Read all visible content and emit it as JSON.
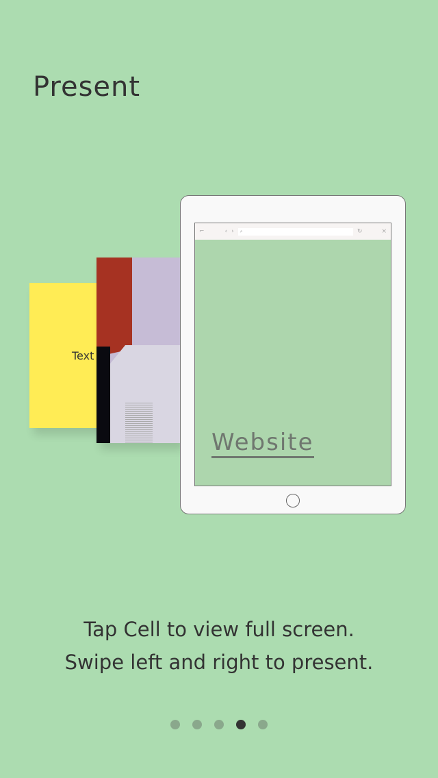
{
  "title": "Present",
  "cards": {
    "text_card_label": "Text",
    "website_label": "Website"
  },
  "browser": {
    "back": "‹",
    "forward": "›",
    "search_icon": "⌕",
    "reload": "↻",
    "close": "×",
    "menu": "⌐"
  },
  "caption": {
    "line1": "Tap Cell to view full screen.",
    "line2": "Swipe left and right to present."
  },
  "pager": {
    "count": 5,
    "active_index": 3
  },
  "colors": {
    "background": "#acdcb0",
    "yellow": "#ffec55",
    "red": "#a63222"
  }
}
